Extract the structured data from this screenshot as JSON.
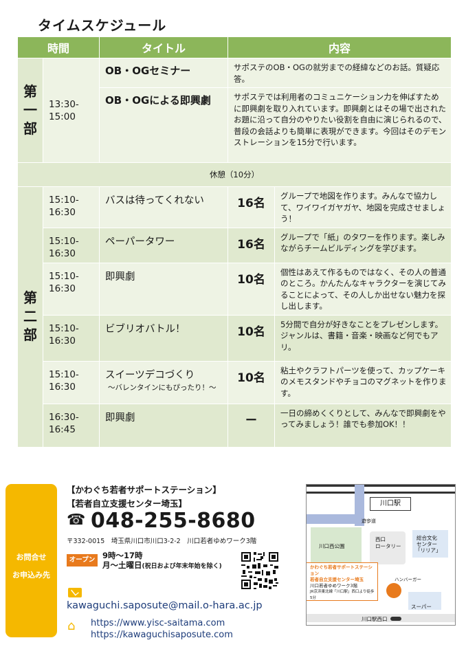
{
  "title": "タイムスケジュール",
  "headers": {
    "time": "時間",
    "title": "タイトル",
    "content": "内容"
  },
  "part1": {
    "label": [
      "第",
      "一",
      "部"
    ],
    "time": [
      "13:30-",
      "15:00"
    ],
    "rows": [
      {
        "title": "OB・OGセミナー",
        "desc": "サポステのOB・OGの就労までの経緯などのお話。質疑応答。"
      },
      {
        "title": "OB・OGによる即興劇",
        "desc": "サポステでは利用者のコミュニケーション力を伸ばすために即興劇を取り入れています。即興劇とはその場で出されたお題に沿って自分のやりたい役割を自由に演じられるので、普段の会話よりも簡単に表現ができます。今回はそのデモンストレーションを15分で行います。"
      }
    ]
  },
  "break": "休憩（10分）",
  "part2": {
    "label": [
      "第",
      "二",
      "部"
    ],
    "rows": [
      {
        "time": [
          "15:10-",
          "16:30"
        ],
        "title": "バスは待ってくれない",
        "count": "16名",
        "desc": "グループで地図を作ります。みんなで協力して、ワイワイガヤガヤ、地図を完成させましょう！"
      },
      {
        "time": [
          "15:10-",
          "16:30"
        ],
        "title": "ペーパータワー",
        "count": "16名",
        "desc": "グループで「紙」のタワーを作ります。楽しみながらチームビルディングを学びます。"
      },
      {
        "time": [
          "15:10-",
          "16:30"
        ],
        "title": "即興劇",
        "count": "10名",
        "desc": "個性はあえて作るものではなく、その人の普通のところ。かんたんなキャラクターを演じてみることによって、その人しか出せない魅力を探し出します。"
      },
      {
        "time": [
          "15:10-",
          "16:30"
        ],
        "title": "ビブリオバトル！",
        "count": "10名",
        "desc": "5分間で自分が好きなことをプレゼンします。ジャンルは、書籍・音楽・映画など何でもアリ。"
      },
      {
        "time": [
          "15:10-",
          "16:30"
        ],
        "title": "スイーツデコづくり",
        "subtitle": "～バレンタインにもぴったり！～",
        "count": "10名",
        "desc": "粘土やクラフトパーツを使って、カップケーキのメモスタンドやチョコのマグネットを作ります。"
      },
      {
        "time": [
          "16:30-",
          "16:45"
        ],
        "title": "即興劇",
        "count": "ー",
        "desc": "一日の締めくくりとして、みんなで即興劇をやってみましょう！誰でも参加OK！！"
      }
    ]
  },
  "contact": {
    "tab": [
      "お問合せ",
      "お申込み先"
    ],
    "org1": "【かわぐち若者サポートステーション】",
    "org2": "【若者自立支援センター埼玉】",
    "phone": "048-255-8680",
    "address": "〒332-0015　埼玉県川口市川口3-2-2　川口若者ゆめワーク3階",
    "open_label": "オープン",
    "hours": "9時～17時",
    "days": "月～土曜日",
    "days_note": "(祝日および年末年始を除く)",
    "email": "kawaguchi.saposute@mail.o-hara.ac.jp",
    "url1": "https://www.yisc-saitama.com",
    "url2": "https://kawaguchisaposute.com"
  },
  "map": {
    "station": "川口駅",
    "walkway": "遊歩道",
    "park": "川口西公園",
    "rotary": [
      "西口",
      "ロータリー"
    ],
    "cultural": [
      "総合文化",
      "センター",
      "「リリア」"
    ],
    "label_org1": "かわぐち若者サポートステーション",
    "label_org2": "若者自立支援センター埼玉",
    "label_addr1": "川口若者ゆめワーク3階",
    "label_addr2": "JR京浜東北線「川口駅」西口より徒歩5分",
    "burger": "ハンバーガー",
    "super": "スーパー",
    "crossing": "川口駅西口"
  },
  "colors": {
    "header": "#8cb65a",
    "row_light": "#eef3e4",
    "row_mid": "#e0e9cf",
    "accent": "#f5b800",
    "open": "#e87a1d",
    "link": "#1d3c7a"
  }
}
